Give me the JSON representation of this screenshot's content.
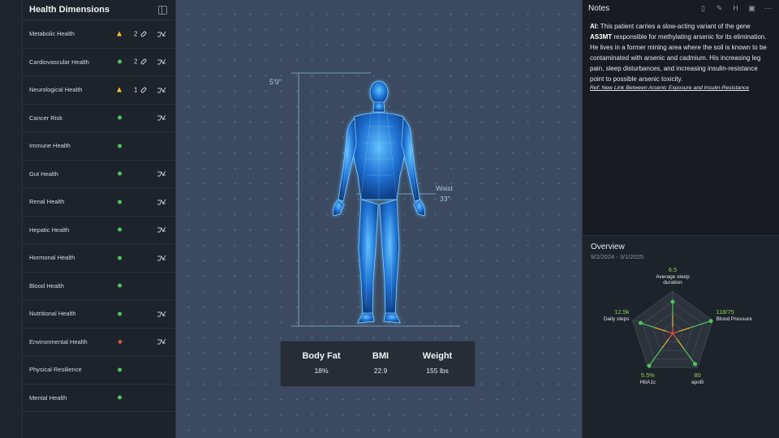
{
  "sidebar": {
    "title": "Health Dimensions",
    "items": [
      {
        "label": "Metabolic Health",
        "status": "warning",
        "count": "2",
        "link": true,
        "trend": true
      },
      {
        "label": "Cardiovascular Health",
        "status": "ok",
        "count": "2",
        "link": true,
        "trend": true
      },
      {
        "label": "Neurological Health",
        "status": "warning",
        "count": "1",
        "link": true,
        "trend": true
      },
      {
        "label": "Cancer Risk",
        "status": "ok",
        "count": "",
        "link": false,
        "trend": true
      },
      {
        "label": "Immune Health",
        "status": "ok",
        "count": "",
        "link": false,
        "trend": false
      },
      {
        "label": "Gut Health",
        "status": "ok",
        "count": "",
        "link": false,
        "trend": true
      },
      {
        "label": "Renal Health",
        "status": "ok",
        "count": "",
        "link": false,
        "trend": true
      },
      {
        "label": "Hepatic Health",
        "status": "ok",
        "count": "",
        "link": false,
        "trend": true
      },
      {
        "label": "Hormonal Health",
        "status": "ok",
        "count": "",
        "link": false,
        "trend": true
      },
      {
        "label": "Blood Health",
        "status": "ok",
        "count": "",
        "link": false,
        "trend": false
      },
      {
        "label": "Nutritional Health",
        "status": "ok",
        "count": "",
        "link": false,
        "trend": true
      },
      {
        "label": "Environmental Health",
        "status": "alert",
        "count": "",
        "link": false,
        "trend": true
      },
      {
        "label": "Physical Resilience",
        "status": "ok",
        "count": "",
        "link": false,
        "trend": false
      },
      {
        "label": "Mental Health",
        "status": "ok",
        "count": "",
        "link": false,
        "trend": false
      }
    ]
  },
  "body": {
    "height": "5'9\"",
    "waist_label": "Waist",
    "waist_value": "33\""
  },
  "metrics": [
    {
      "label": "Body Fat",
      "value": "18%"
    },
    {
      "label": "BMI",
      "value": "22.9"
    },
    {
      "label": "Weight",
      "value": "155 lbs"
    }
  ],
  "notes": {
    "title": "Notes",
    "prefix": "AI:",
    "text_1": " This patient carries a slow-acting variant of the gene ",
    "gene": "AS3MT",
    "text_2": " responsible for methylating arsenic for its elimination. He lives in a former mining area where the soil is known to be contaminated with arsenic and cadmium. His increasing leg pain, sleep disturbances, and increasing insulin-resistance point to possible arsenic toxicity.",
    "reference": "Ref: New Link Between Arsenic Exposure and Insulin-Resistance"
  },
  "overview": {
    "title": "Overview",
    "date_range": "9/2/2024 - 3/1/2025",
    "axes": [
      {
        "label": "Average sleep duration",
        "value": "6.5",
        "level": 0.75
      },
      {
        "label": "Blood Pressure",
        "value": "118/75",
        "level": 0.95
      },
      {
        "label": "apoB",
        "value": "80",
        "level": 0.9
      },
      {
        "label": "HbA1c",
        "value": "5.5%",
        "level": 0.95
      },
      {
        "label": "Daily steps",
        "value": "12.5k",
        "level": 0.8
      }
    ],
    "colors": {
      "good": "#4cc85a",
      "warn": "#e0b830",
      "bad": "#e05545",
      "grid": "#4a525c"
    }
  },
  "colors": {
    "status_ok": "#4cc85a",
    "status_warning": "#f2c230",
    "status_alert": "#e0554c",
    "body_glow": "#3aa0ff"
  }
}
